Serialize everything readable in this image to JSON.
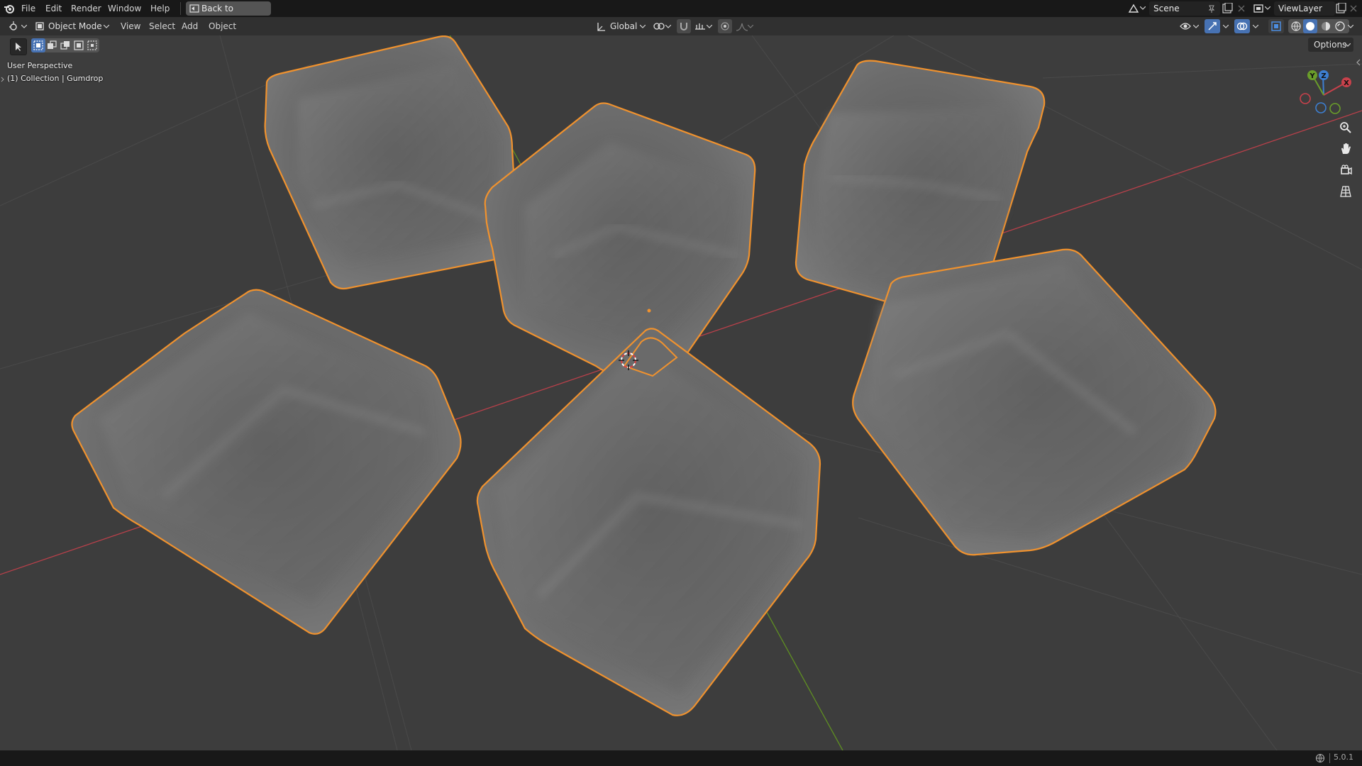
{
  "topbar": {
    "menus": [
      "File",
      "Edit",
      "Render",
      "Window",
      "Help"
    ],
    "back_button": "Back to Previous",
    "scene_name": "Scene",
    "view_layer": "ViewLayer"
  },
  "header": {
    "mode": "Object Mode",
    "menus": [
      "View",
      "Select",
      "Add",
      "Object"
    ],
    "transform_orientation": "Global",
    "options_label": "Options"
  },
  "viewport": {
    "perspective_label": "User Perspective",
    "collection_label": "(1) Collection | Gumdrop",
    "gizmo_axes": [
      "X",
      "Y",
      "Z"
    ],
    "axis_colors": {
      "x": "#c8414b",
      "y": "#6a9e2a",
      "z": "#3d7fd1"
    },
    "selection_color": "#f0922e",
    "object_count": 6
  },
  "statusbar": {
    "version": "5.0.1"
  }
}
